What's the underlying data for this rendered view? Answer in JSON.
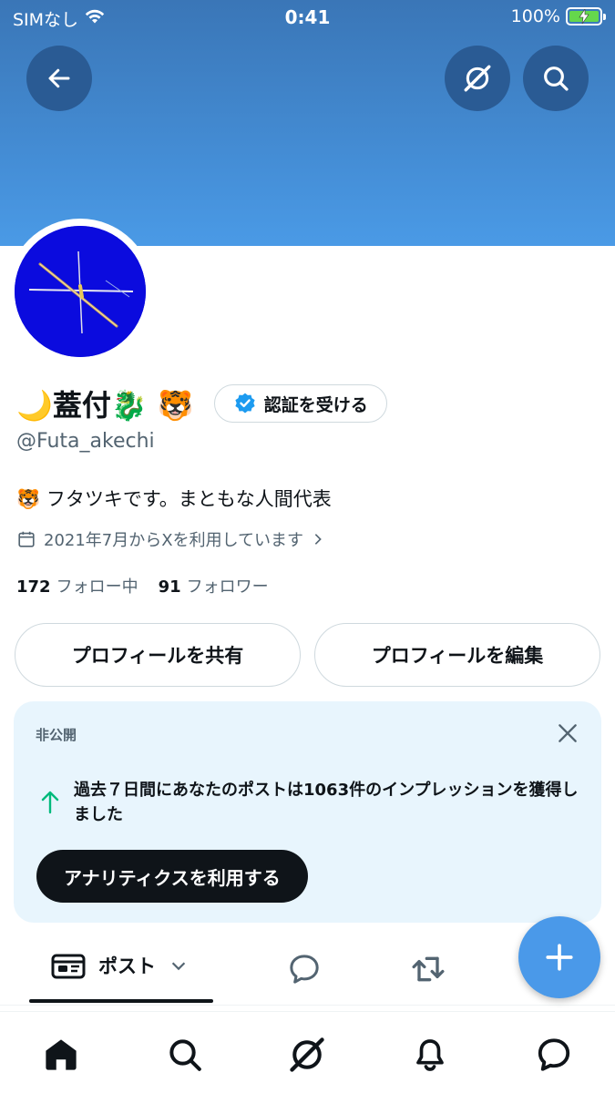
{
  "status_bar": {
    "carrier": "SIMなし",
    "time": "0:41",
    "battery_percent": "100%",
    "icons": [
      "wifi-icon",
      "battery-charging-icon"
    ]
  },
  "header": {
    "back_icon": "arrow-left-icon",
    "grok_icon": "grok-icon",
    "search_icon": "search-icon"
  },
  "profile": {
    "name": "🌙蓋付🐉 🐯",
    "verify_label": "認証を受ける",
    "handle": "@Futa_akechi",
    "bio": "🐯 フタツキです。まともな人間代表",
    "joined": "2021年7月からXを利用しています",
    "following_count": "172",
    "following_label": "フォロー中",
    "followers_count": "91",
    "followers_label": "フォロワー"
  },
  "actions": {
    "share_label": "プロフィールを共有",
    "edit_label": "プロフィールを編集"
  },
  "private_card": {
    "label": "非公開",
    "message": "過去７日間にあなたのポストは1063件のインプレッションを獲得しました",
    "button_label": "アナリティクスを利用する"
  },
  "tabs": {
    "post_label": "ポスト"
  },
  "colors": {
    "accent": "#1d9bf0",
    "fab": "#4a99e9",
    "banner_top": "#3a76b7",
    "banner_bottom": "#4a9ae6",
    "card_bg": "#e8f5fd",
    "growth_arrow": "#00ba7c"
  },
  "bottom_nav": [
    "home-icon",
    "search-icon",
    "grok-icon",
    "bell-icon",
    "messages-icon"
  ]
}
